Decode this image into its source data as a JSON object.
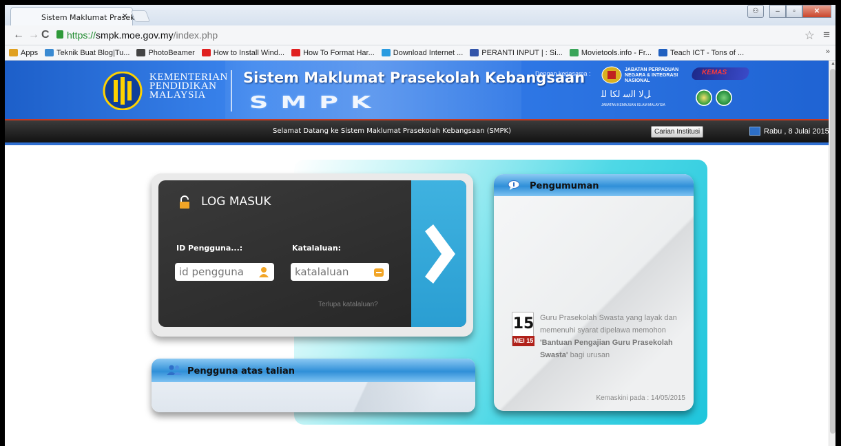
{
  "browser": {
    "tab_title": "Sistem Maklumat Prasekol",
    "url_scheme": "https://",
    "url_host": "smpk.moe.gov.my",
    "url_path": "/index.php",
    "bookmarks": [
      {
        "label": "Apps",
        "icon": "apps-grid-icon",
        "color": "#e0a020"
      },
      {
        "label": "Teknik Buat Blog|Tu...",
        "icon": "blog-favicon",
        "color": "#3a8ad2"
      },
      {
        "label": "PhotoBeamer",
        "icon": "paper-plane-icon",
        "color": "#444444"
      },
      {
        "label": "How to Install Wind...",
        "icon": "youtube-icon",
        "color": "#e02020"
      },
      {
        "label": "How To Format Har...",
        "icon": "youtube-icon",
        "color": "#e02020"
      },
      {
        "label": "Download Internet ...",
        "icon": "windows-favicon",
        "color": "#2a9be0"
      },
      {
        "label": "PERANTI INPUT | : Si...",
        "icon": "blog-favicon",
        "color": "#3355aa"
      },
      {
        "label": "Movietools.info - Fr...",
        "icon": "m-favicon",
        "color": "#3aa55a"
      },
      {
        "label": "Teach ICT - Tons of ...",
        "icon": "w-favicon",
        "color": "#2060c0"
      }
    ],
    "bookmarks_more": "»"
  },
  "header": {
    "ministry_line1": "KEMENTERIAN",
    "ministry_line2": "PENDIDIKAN",
    "ministry_line3": "MALAYSIA",
    "title": "Sistem Maklumat Prasekolah Kebangsaan",
    "logo_text": "SMPK",
    "partner_label": "Dengan kerjasama :",
    "jpn_text": "JABATAN PERPADUAN NEGARA & INTEGRASI NASIONAL",
    "kemas_text": "KEMAS",
    "jakim_text": "JABATAN KEMAJUAN ISLAM MALAYSIA"
  },
  "navbar": {
    "welcome": "Selamat Datang ke Sistem Maklumat Prasekolah Kebangsaan (SMPK)",
    "search_button": "Carian Institusi",
    "date": "Rabu , 8 Julai 2015"
  },
  "login": {
    "title": "LOG MASUK",
    "id_label": "ID Pengguna...:",
    "id_placeholder": "id pengguna",
    "pw_label": "Katalaluan:",
    "pw_placeholder": "katalaluan",
    "forgot": "Terlupa katalaluan?"
  },
  "online": {
    "title": "Pengguna atas talian"
  },
  "announcement": {
    "title": "Pengumuman",
    "day": "15",
    "month": "MEI 15",
    "text_before": "Guru Prasekolah Swasta yang layak dan memenuhi syarat dipelawa memohon ",
    "text_bold": "'Bantuan Pengajian Guru Prasekolah Swasta'",
    "text_after": " bagi urusan",
    "updated": "Kemaskini pada : 14/05/2015"
  }
}
